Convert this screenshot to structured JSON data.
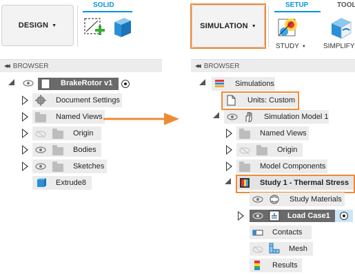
{
  "left": {
    "workspace_label": "DESIGN",
    "tab_label": "SOLID",
    "browser_label": "BROWSER",
    "tree": [
      {
        "label": "BrakeRotor v1"
      },
      {
        "label": "Document Settings"
      },
      {
        "label": "Named Views"
      },
      {
        "label": "Origin"
      },
      {
        "label": "Bodies"
      },
      {
        "label": "Sketches"
      },
      {
        "label": "Extrude8"
      }
    ]
  },
  "right": {
    "workspace_label": "SIMULATION",
    "tab_setup_label": "SETUP",
    "tab_tools_label": "TOOL",
    "study_label": "STUDY",
    "simplify_label": "SIMPLIFY",
    "browser_label": "BROWSER",
    "tree": [
      {
        "label": "Simulations"
      },
      {
        "label": "Units: Custom"
      },
      {
        "label": "Simulation Model 1"
      },
      {
        "label": "Named Views"
      },
      {
        "label": "Origin"
      },
      {
        "label": "Model Components"
      },
      {
        "label": "Study 1 - Thermal Stress"
      },
      {
        "label": "Study Materials"
      },
      {
        "label": "Load Case1"
      },
      {
        "label": "Contacts"
      },
      {
        "label": "Mesh"
      },
      {
        "label": "Results"
      }
    ]
  },
  "colors": {
    "highlight": "#ef8a34",
    "accent_blue": "#0696d7",
    "arrow": "#ef8a34"
  },
  "icons": [
    "eye-icon",
    "gear-icon",
    "folder-icon",
    "document-icon",
    "body-icon",
    "sketch-icon",
    "extrude-icon",
    "simulations-icon",
    "hand-icon",
    "thermal-study-icon",
    "materials-icon",
    "load-case-icon",
    "contacts-icon",
    "mesh-icon",
    "results-icon",
    "radio-icon",
    "arrow-right-icon"
  ]
}
